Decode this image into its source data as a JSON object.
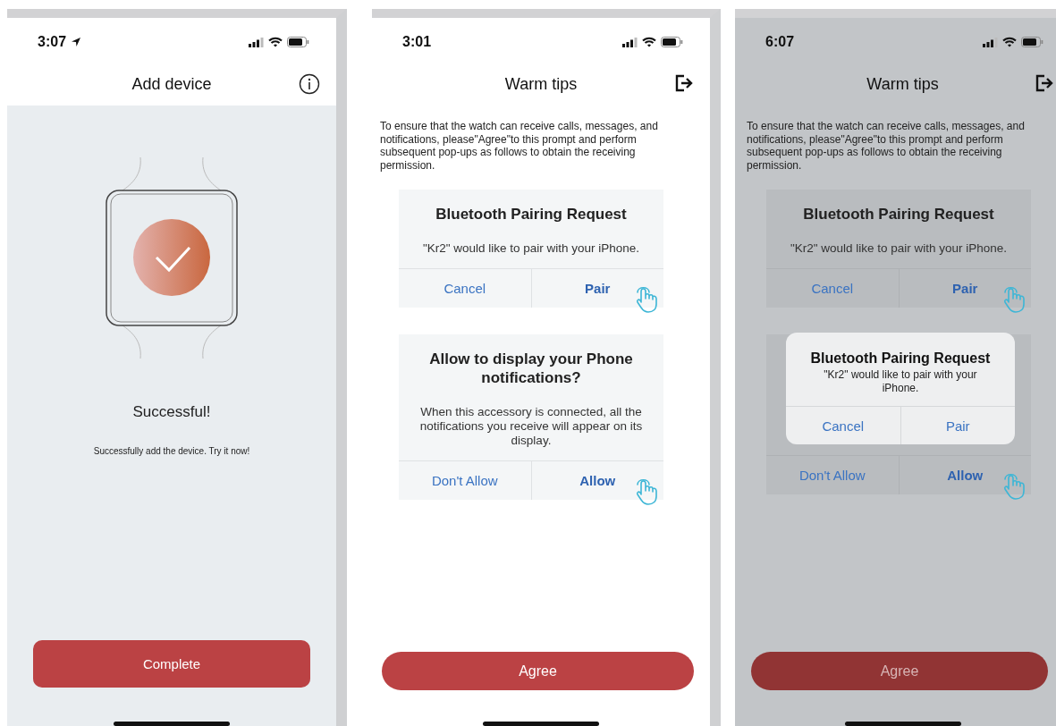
{
  "screens": [
    {
      "kind": "success",
      "dimmed": false,
      "status_bar": {
        "time": "3:07",
        "location": true
      },
      "header": {
        "title": "Add device"
      },
      "heading": "Successful!",
      "message": "Successfully add the device. Try it now!",
      "button": "Complete"
    },
    {
      "kind": "tips",
      "dimmed": false,
      "status_bar": {
        "time": "3:01",
        "location": false
      },
      "header": {
        "title": "Warm tips"
      },
      "intro": "To ensure that the watch can receive calls, messages, and notifications, please\"Agree\"to this prompt and perform subsequent pop-ups as follows to obtain the receiving permission.",
      "cards": [
        {
          "title": "Bluetooth Pairing Request",
          "body": "\"Kr2\" would like to pair with your iPhone.",
          "buttons": [
            {
              "label": "Cancel",
              "primary": false,
              "tapped": false
            },
            {
              "label": "Pair",
              "primary": true,
              "tapped": true
            }
          ]
        },
        {
          "title": "Allow to display your Phone notifications?",
          "body": "When this accessory is connected, all the notifications you receive will appear on its display.",
          "buttons": [
            {
              "label": "Don't Allow",
              "primary": false,
              "tapped": false
            },
            {
              "label": "Allow",
              "primary": true,
              "tapped": true
            }
          ]
        }
      ],
      "button": "Agree"
    },
    {
      "kind": "tips",
      "dimmed": true,
      "status_bar": {
        "time": "6:07",
        "location": false
      },
      "header": {
        "title": "Warm tips"
      },
      "intro": "To ensure that the watch can receive calls, messages, and notifications, please\"Agree\"to this prompt and perform subsequent pop-ups as follows to obtain the receiving permission.",
      "cards": [
        {
          "title": "Bluetooth Pairing Request",
          "body": "\"Kr2\" would like to pair with your iPhone.",
          "buttons": [
            {
              "label": "Cancel",
              "primary": false,
              "tapped": false
            },
            {
              "label": "Pair",
              "primary": true,
              "tapped": true
            }
          ]
        },
        {
          "buttons": [
            {
              "label": "Don't Allow",
              "primary": false,
              "tapped": false
            },
            {
              "label": "Allow",
              "primary": true,
              "tapped": true
            }
          ]
        }
      ],
      "button": "Agree",
      "alert": {
        "title": "Bluetooth Pairing Request",
        "message": "\"Kr2\" would like to pair with your iPhone.",
        "buttons": [
          {
            "label": "Cancel"
          },
          {
            "label": "Pair"
          }
        ]
      }
    }
  ]
}
